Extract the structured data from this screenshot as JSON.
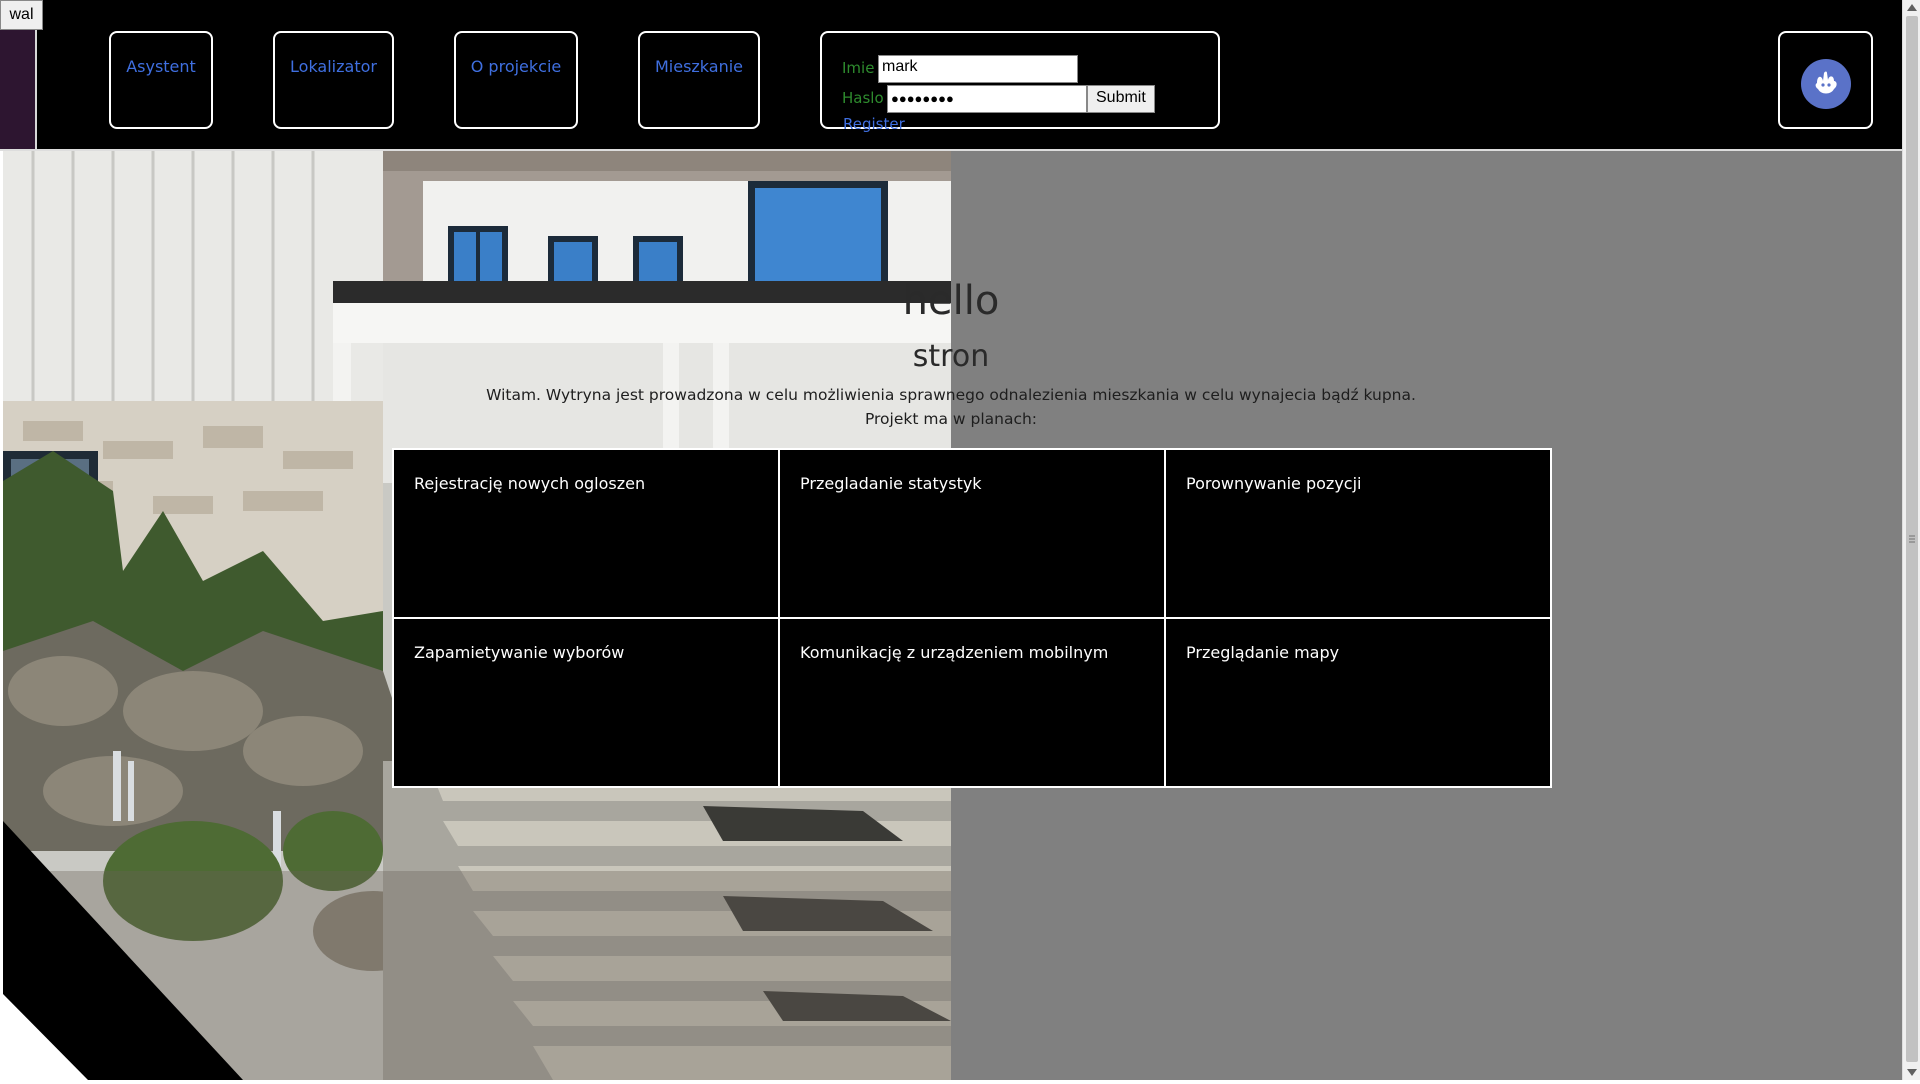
{
  "top_button": {
    "label": "wal"
  },
  "nav": [
    {
      "label": "Asystent"
    },
    {
      "label": "Lokalizator"
    },
    {
      "label": "O projekcie"
    },
    {
      "label": "Mieszkanie"
    }
  ],
  "login": {
    "name_label": "Imie",
    "name_value": "mark",
    "password_label": "Haslo",
    "password_value": "●●●●●●●●",
    "submit_label": "Submit",
    "register_label": "Register"
  },
  "hero": {
    "title": "hello",
    "subtitle": "stron",
    "description": "Witam. Wytryna jest prowadzona w celu możliwienia sprawnego odnalezienia mieszkania w celu wynajecia bądź kupna.",
    "plans_intro": "Projekt ma w planach:"
  },
  "features": [
    "Rejestrację nowych ogloszen",
    "Przegladanie statystyk",
    "Porownywanie pozycji",
    "Zapamietywanie wyborów",
    "Komunikację z urządzeniem mobilnym",
    "Przeglądanie mapy"
  ],
  "colors": {
    "nav_link": "#3f6fe0",
    "login_label": "#2e8b2e",
    "avatar": "#5a72c8",
    "content_bg": "#808080"
  },
  "icons": {
    "avatar": "user-avatar-icon"
  }
}
